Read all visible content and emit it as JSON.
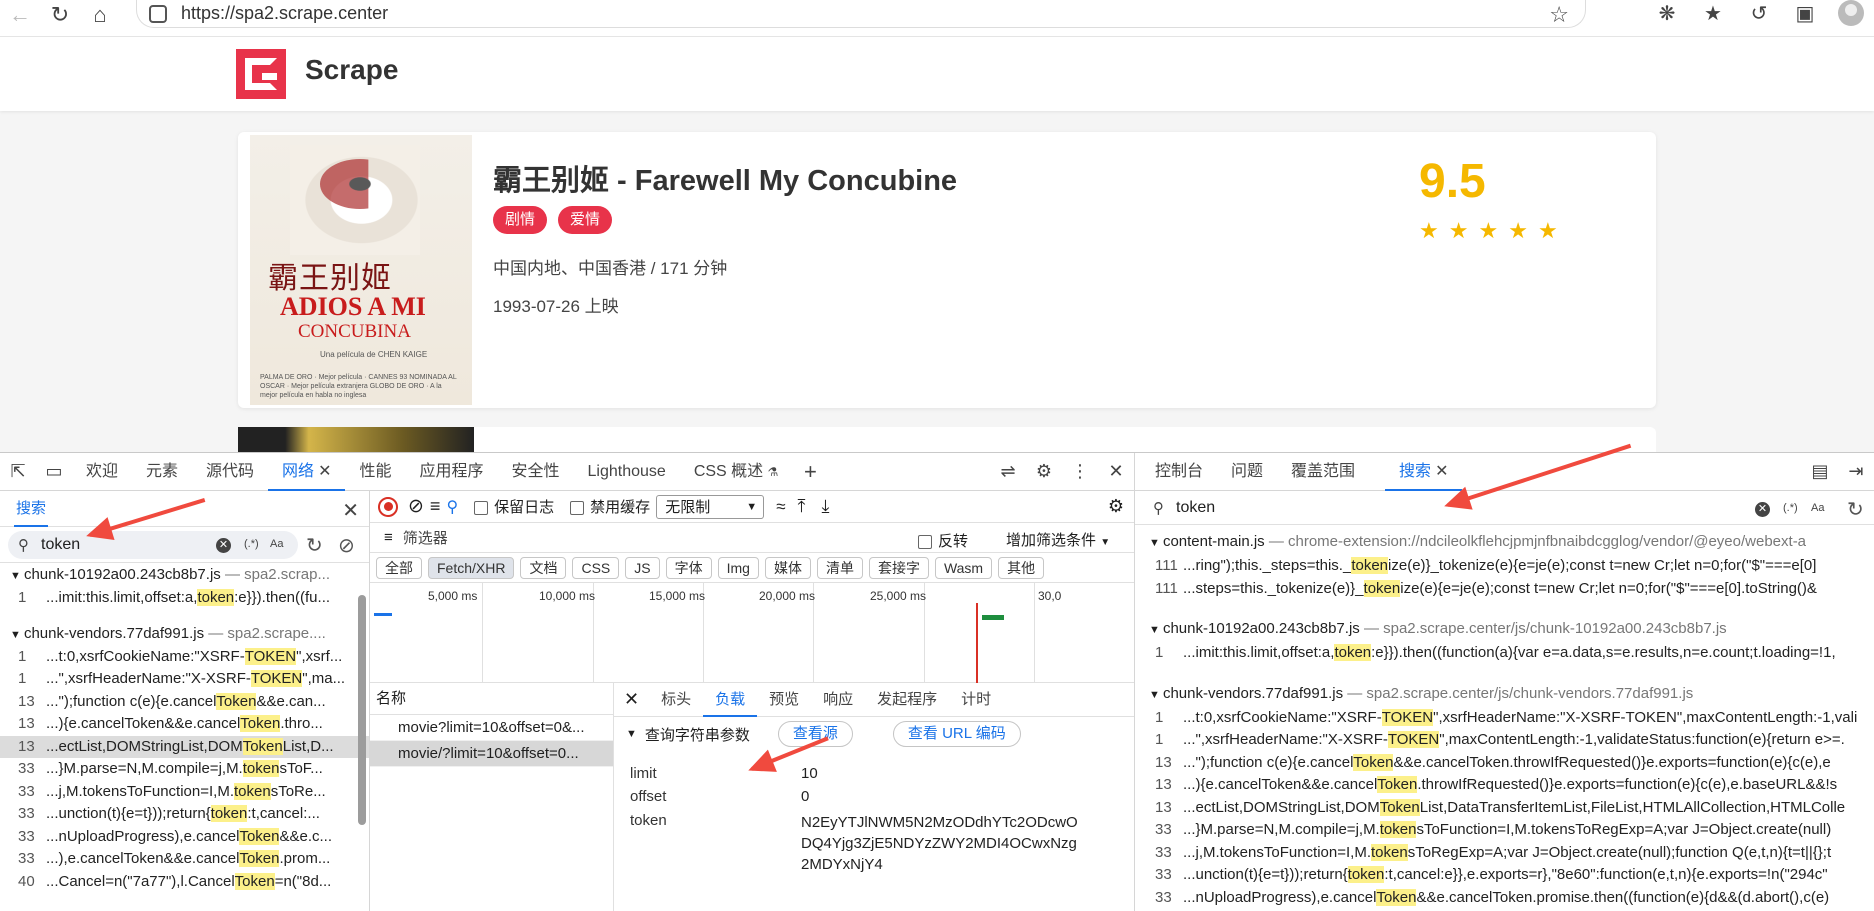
{
  "browser": {
    "url": "https://spa2.scrape.center"
  },
  "site": {
    "name": "Scrape"
  },
  "movie": {
    "title": "霸王别姬 - Farewell My Concubine",
    "tags": [
      "剧情",
      "爱情"
    ],
    "region_duration": "中国内地、中国香港 / 171 分钟",
    "release": "1993-07-26 上映",
    "score": "9.5",
    "stars": 5,
    "poster": {
      "cn_title": "霸王别姬",
      "en_line1": "ADIOS A MI",
      "en_line2": "CONCUBINA",
      "credit": "Una película de CHEN KAIGE",
      "awards": "PALMA DE ORO · Mejor película · CANNES 93 NOMINADA AL OSCAR · Mejor película extranjera GLOBO DE ORO · A la mejor película en habla no inglesa"
    }
  },
  "devtools": {
    "tabs": [
      "欢迎",
      "元素",
      "源代码",
      "网络",
      "性能",
      "应用程序",
      "安全性",
      "Lighthouse",
      "CSS 概述"
    ],
    "right_tabs": [
      "控制台",
      "问题",
      "覆盖范围",
      "搜索"
    ],
    "left_search": {
      "title": "搜索",
      "query": "token",
      "regex": "(.*)",
      "case": "Aa",
      "results": [
        {
          "file": "chunk-10192a00.243cb8b7.js",
          "origin": "— spa2.scrap...",
          "lines": [
            {
              "n": "1",
              "pre": "...imit:this.limit,offset:a,",
              "hl": "token",
              "post": ":e}}).then((fu..."
            }
          ]
        },
        {
          "file": "chunk-vendors.77daf991.js",
          "origin": "— spa2.scrape....",
          "lines": [
            {
              "n": "1",
              "pre": "...t:0,xsrfCookieName:\"XSRF-",
              "hl": "TOKEN",
              "post": "\",xsrf..."
            },
            {
              "n": "1",
              "pre": "...\",xsrfHeaderName:\"X-XSRF-",
              "hl": "TOKEN",
              "post": "\",ma..."
            },
            {
              "n": "13",
              "pre": "...\");function c(e){e.cancel",
              "hl": "Token",
              "post": "&&e.can..."
            },
            {
              "n": "13",
              "pre": "...){e.cancelToken&&e.cancel",
              "hl": "Token",
              "post": ".thro..."
            },
            {
              "n": "13",
              "pre": "...ectList,DOMStringList,DOM",
              "hl": "Token",
              "post": "List,D..."
            },
            {
              "n": "33",
              "pre": "...}M.parse=N,M.compile=j,M.",
              "hl": "token",
              "post": "sToF..."
            },
            {
              "n": "33",
              "pre": "...j,M.tokensToFunction=I,M.",
              "hl": "token",
              "post": "sToRe..."
            },
            {
              "n": "33",
              "pre": "...unction(t){e=t}));return{",
              "hl": "token",
              "post": ":t,cancel:..."
            },
            {
              "n": "33",
              "pre": "...nUploadProgress),e.cancel",
              "hl": "Token",
              "post": "&&e.c..."
            },
            {
              "n": "33",
              "pre": "...),e.cancelToken&&e.cancel",
              "hl": "Token",
              "post": ".prom..."
            },
            {
              "n": "40",
              "pre": "...Cancel=n(\"7a77\"),l.Cancel",
              "hl": "Token",
              "post": "=n(\"8d..."
            }
          ]
        }
      ]
    },
    "network": {
      "preserve_log": "保留日志",
      "disable_cache": "禁用缓存",
      "throttle": "无限制",
      "filter_placeholder": "筛选器",
      "invert": "反转",
      "more_filters": "增加筛选条件",
      "types": [
        "全部",
        "Fetch/XHR",
        "文档",
        "CSS",
        "JS",
        "字体",
        "Img",
        "媒体",
        "清单",
        "套接字",
        "Wasm",
        "其他"
      ],
      "active_type": "Fetch/XHR",
      "timeline_labels": [
        "5,000 ms",
        "10,000 ms",
        "15,000 ms",
        "20,000 ms",
        "25,000 ms",
        "30,0"
      ],
      "list_header": "名称",
      "requests": [
        "movie?limit=10&offset=0&...",
        "movie/?limit=10&offset=0..."
      ],
      "detail_tabs": [
        "标头",
        "负载",
        "预览",
        "响应",
        "发起程序",
        "计时"
      ],
      "active_detail_tab": "负载",
      "query_section": "查询字符串参数",
      "view_source": "查看源",
      "view_url_encoded": "查看 URL 编码",
      "params": [
        {
          "key": "limit",
          "value": "10"
        },
        {
          "key": "offset",
          "value": "0"
        },
        {
          "key": "token",
          "value": "N2EyYTJlNWM5N2MzODdhYTc2ODcwODQ4Yjg3ZjE5NDYzZWY2MDI4OCwxNzg2MDYxNjY4"
        }
      ],
      "token_lines": [
        "N2EyYTJlNWM5N2MzODdhYTc2ODcwO",
        "DQ4Yjg3ZjE5NDYzZWY2MDI4OCwxNzg",
        "2MDYxNjY4"
      ]
    },
    "right_search": {
      "query": "token",
      "regex": "(.*)",
      "case": "Aa",
      "results": [
        {
          "file": "content-main.js",
          "origin": "— chrome-extension://ndcileolkflehcjpmjnfbnaibdcgglog/vendor/@eyeo/webext-a",
          "lines": [
            {
              "n": "111",
              "pre": "...ring\");this._steps=this._",
              "hl": "token",
              "post": "ize(e)}_tokenize(e){e=je(e);const t=new Cr;let n=0;for(\"$\"===e[0]"
            },
            {
              "n": "111",
              "pre": "...steps=this._tokenize(e)}_",
              "hl": "token",
              "post": "ize(e){e=je(e);const t=new Cr;let n=0;for(\"$\"===e[0].toString()&"
            }
          ]
        },
        {
          "file": "chunk-10192a00.243cb8b7.js",
          "origin": "— spa2.scrape.center/js/chunk-10192a00.243cb8b7.js",
          "lines": [
            {
              "n": "1",
              "pre": "...imit:this.limit,offset:a,",
              "hl": "token",
              "post": ":e}}).then((function(a){var e=a.data,s=e.results,n=e.count;t.loading=!1,"
            }
          ]
        },
        {
          "file": "chunk-vendors.77daf991.js",
          "origin": "— spa2.scrape.center/js/chunk-vendors.77daf991.js",
          "lines": [
            {
              "n": "1",
              "pre": "...t:0,xsrfCookieName:\"XSRF-",
              "hl": "TOKEN",
              "post": "\",xsrfHeaderName:\"X-XSRF-TOKEN\",maxContentLength:-1,vali"
            },
            {
              "n": "1",
              "pre": "...\",xsrfHeaderName:\"X-XSRF-",
              "hl": "TOKEN",
              "post": "\",maxContentLength:-1,validateStatus:function(e){return e>=."
            },
            {
              "n": "13",
              "pre": "...\");function c(e){e.cancel",
              "hl": "Token",
              "post": "&&e.cancelToken.throwIfRequested()}e.exports=function(e){c(e),e"
            },
            {
              "n": "13",
              "pre": "...){e.cancelToken&&e.cancel",
              "hl": "Token",
              "post": ".throwIfRequested()}e.exports=function(e){c(e),e.baseURL&&!s"
            },
            {
              "n": "13",
              "pre": "...ectList,DOMStringList,DOM",
              "hl": "Token",
              "post": "List,DataTransferItemList,FileList,HTMLAllCollection,HTMLColle"
            },
            {
              "n": "33",
              "pre": "...}M.parse=N,M.compile=j,M.",
              "hl": "token",
              "post": "sToFunction=I,M.tokensToRegExp=A;var J=Object.create(null)"
            },
            {
              "n": "33",
              "pre": "...j,M.tokensToFunction=I,M.",
              "hl": "token",
              "post": "sToRegExp=A;var J=Object.create(null);function Q(e,t,n){t=t||{};t"
            },
            {
              "n": "33",
              "pre": "...unction(t){e=t}));return{",
              "hl": "token",
              "post": ":t,cancel:e}},e.exports=r},\"8e60\":function(e,t,n){e.exports=!n(\"294c\""
            },
            {
              "n": "33",
              "pre": "...nUploadProgress),e.cancel",
              "hl": "Token",
              "post": "&&e.cancelToken.promise.then((function(e){d&&(d.abort(),c(e)"
            },
            {
              "n": "33",
              "pre": "...),e.cancelToken&&e.cancel",
              "hl": "Token",
              "post": ".promise.then((function(e){d&&(d.abort(),c(e),d=null)})),void 0"
            }
          ]
        }
      ]
    }
  },
  "colors": {
    "brand": "#e8334a",
    "score": "#f5b800",
    "accent": "#1a73e8",
    "highlight": "#fcf08a",
    "annotation": "#f04a3e"
  }
}
